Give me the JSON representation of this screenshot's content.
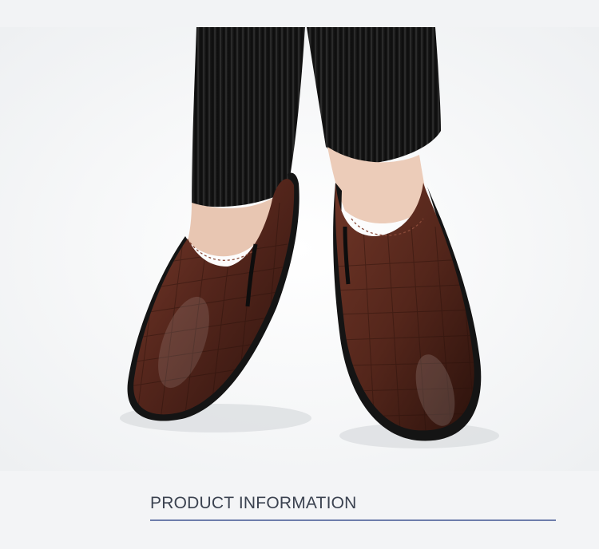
{
  "section": {
    "title": "PRODUCT INFORMATION"
  },
  "photo": {
    "subject": "brown-leather-slip-on-loafers"
  },
  "colors": {
    "background": "#f3f4f6",
    "leather": "#5a2b20",
    "sole": "#141414",
    "trousers": "#161616",
    "rule": "#6d7dab"
  }
}
